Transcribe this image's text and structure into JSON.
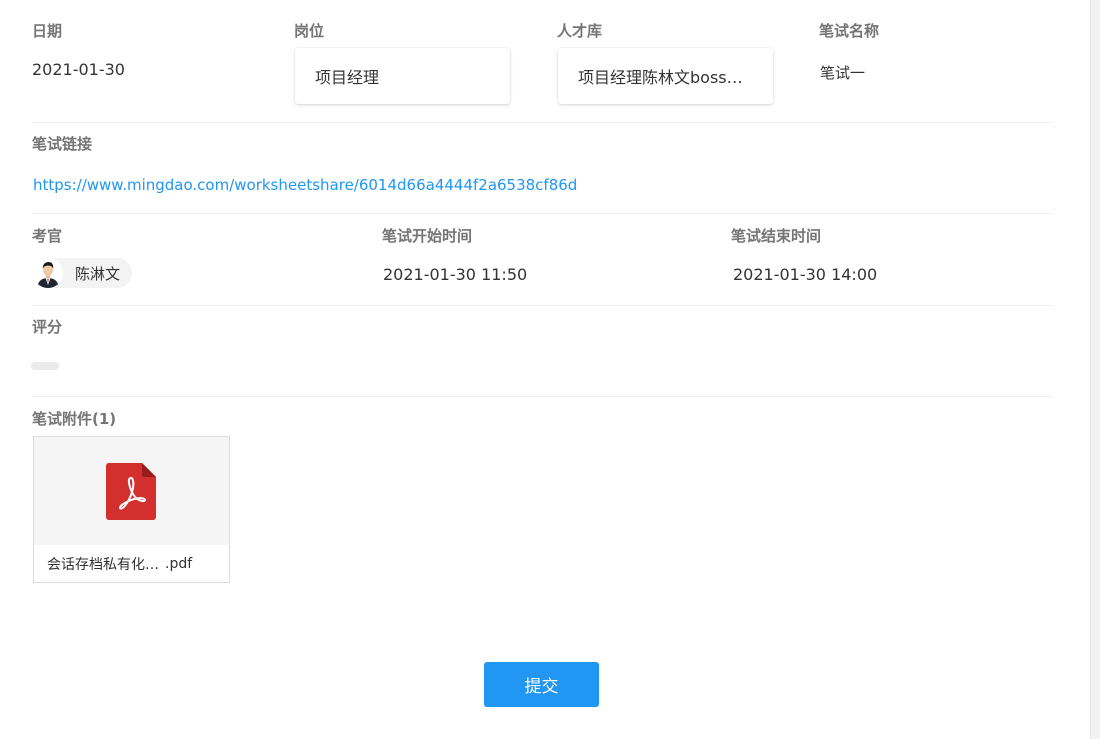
{
  "fields": {
    "date": {
      "label": "日期",
      "value": "2021-01-30"
    },
    "position": {
      "label": "岗位",
      "value": "项目经理"
    },
    "talent_pool": {
      "label": "人才库",
      "value": "项目经理陈林文boss直聘"
    },
    "exam_name": {
      "label": "笔试名称",
      "value": "笔试一"
    },
    "exam_link": {
      "label": "笔试链接",
      "value": "https://www.mingdao.com/worksheetshare/6014d66a4444f2a6538cf86d"
    },
    "examiner": {
      "label": "考官",
      "value": "陈淋文"
    },
    "start_time": {
      "label": "笔试开始时间",
      "value": "2021-01-30 11:50"
    },
    "end_time": {
      "label": "笔试结束时间",
      "value": "2021-01-30 14:00"
    },
    "score": {
      "label": "评分",
      "value": ""
    },
    "attachments": {
      "label": "笔试附件(1)",
      "items": [
        {
          "name": "会话存档私有化…",
          "ext": ".pdf",
          "icon": "pdf-icon"
        }
      ]
    }
  },
  "actions": {
    "submit_label": "提交"
  },
  "colors": {
    "accent": "#2196f3",
    "pdf_red": "#d32f2f",
    "label_gray": "#757575"
  }
}
